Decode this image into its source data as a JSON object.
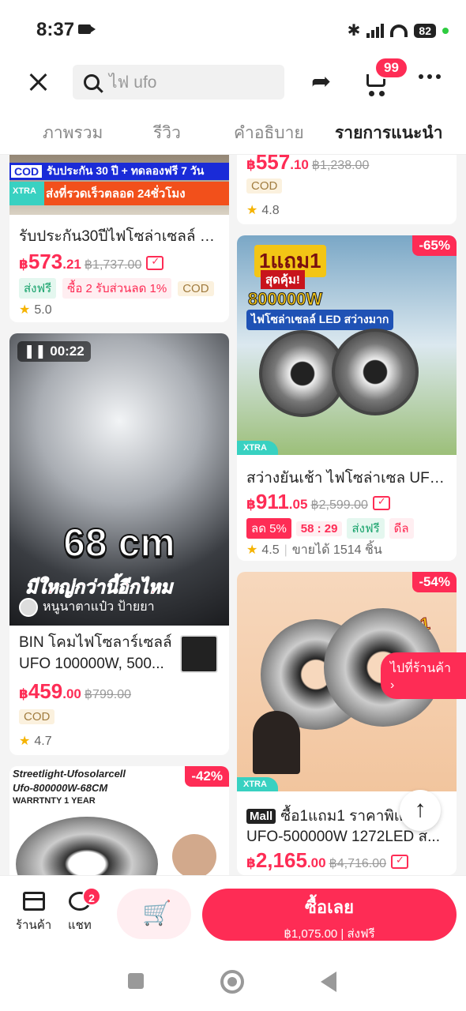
{
  "status": {
    "time": "8:37",
    "battery": "82"
  },
  "header": {
    "search_placeholder": "ไฟ ufo",
    "cart_count": "99"
  },
  "tabs": [
    "ภาพรวม",
    "รีวิว",
    "คำอธิบาย",
    "รายการแนะนำ"
  ],
  "cards": {
    "c1": {
      "banner_cod": "COD",
      "banner_text": "รับประกัน 30 ปี + ทดลองฟรี 7 วัน",
      "banner_bottom": "ส่งที่รวดเร็วตลอด 24ชั่วโมง",
      "xtra": "XTRA",
      "title": "รับประกัน30ปีไฟโซล่าเซลล์ UF...",
      "price_int": "573",
      "price_dec": ".21",
      "price_old": "฿1,737.00",
      "tags": [
        "ส่งฟรี",
        "ซื้อ 2 รับส่วนลด 1%",
        "COD"
      ],
      "rating": "5.0"
    },
    "c2": {
      "price_int": "557",
      "price_dec": ".10",
      "price_old": "฿1,238.00",
      "cod": "COD",
      "rating": "4.8"
    },
    "c3": {
      "video_time": "00:22",
      "big_text": "68 cm",
      "sub_text": "มีใหญ่กว่านี้อีกไหม",
      "creator": "หนูนาตาแป๋ว ป้ายยา",
      "title_line1": "BIN โคมไฟโซลาร์เซลล์",
      "title_line2": "UFO 100000W, 500...",
      "price_int": "459",
      "price_dec": ".00",
      "price_old": "฿799.00",
      "cod": "COD",
      "rating": "4.7"
    },
    "c4": {
      "discount": "-65%",
      "promo1": "1แถม1",
      "promo2": "สุดคุ้ม!",
      "watt": "800000W",
      "caption": "ไฟโซล่าเซลล์ LED สว่างมาก",
      "xtra": "XTRA",
      "title": "สว่างยันเช้า ไฟโซล่าเซล UFO S...",
      "price_int": "911",
      "price_dec": ".05",
      "price_old": "฿2,599.00",
      "tags": [
        "ลด 5%",
        "58 : 29",
        "ส่งฟรี",
        "ดีล"
      ],
      "rating": "4.5",
      "sold": "ขายได้ 1514 ชิ้น"
    },
    "c5": {
      "discount": "-54%",
      "promo": "ซื้อ1แถม1",
      "xtra": "XTRA",
      "mall": "Mall",
      "title_line1": "ซื้อ1แถม1 ราคาพิเศ",
      "title_line2": "UFO-500000W 1272LED ส...",
      "price_int": "2,165",
      "price_dec": ".00",
      "price_old": "฿4,716.00"
    },
    "c6": {
      "line1": "Streetlight-Ufosolarcell",
      "line2": "Ufo-800000W-68CM",
      "line3": "WARRTNTY 1 YEAR",
      "discount": "-42%"
    }
  },
  "currency": "฿",
  "floating": {
    "go_shop": "ไปที่ร้านค้า"
  },
  "bottom": {
    "shop": "ร้านค้า",
    "chat": "แชท",
    "chat_badge": "2",
    "buy": "ซื้อเลย",
    "buy_price": "฿1,075.00",
    "buy_ship": "ส่งฟรี"
  },
  "colors": {
    "accent": "#fe2c55",
    "xtra": "#38d1c1"
  }
}
